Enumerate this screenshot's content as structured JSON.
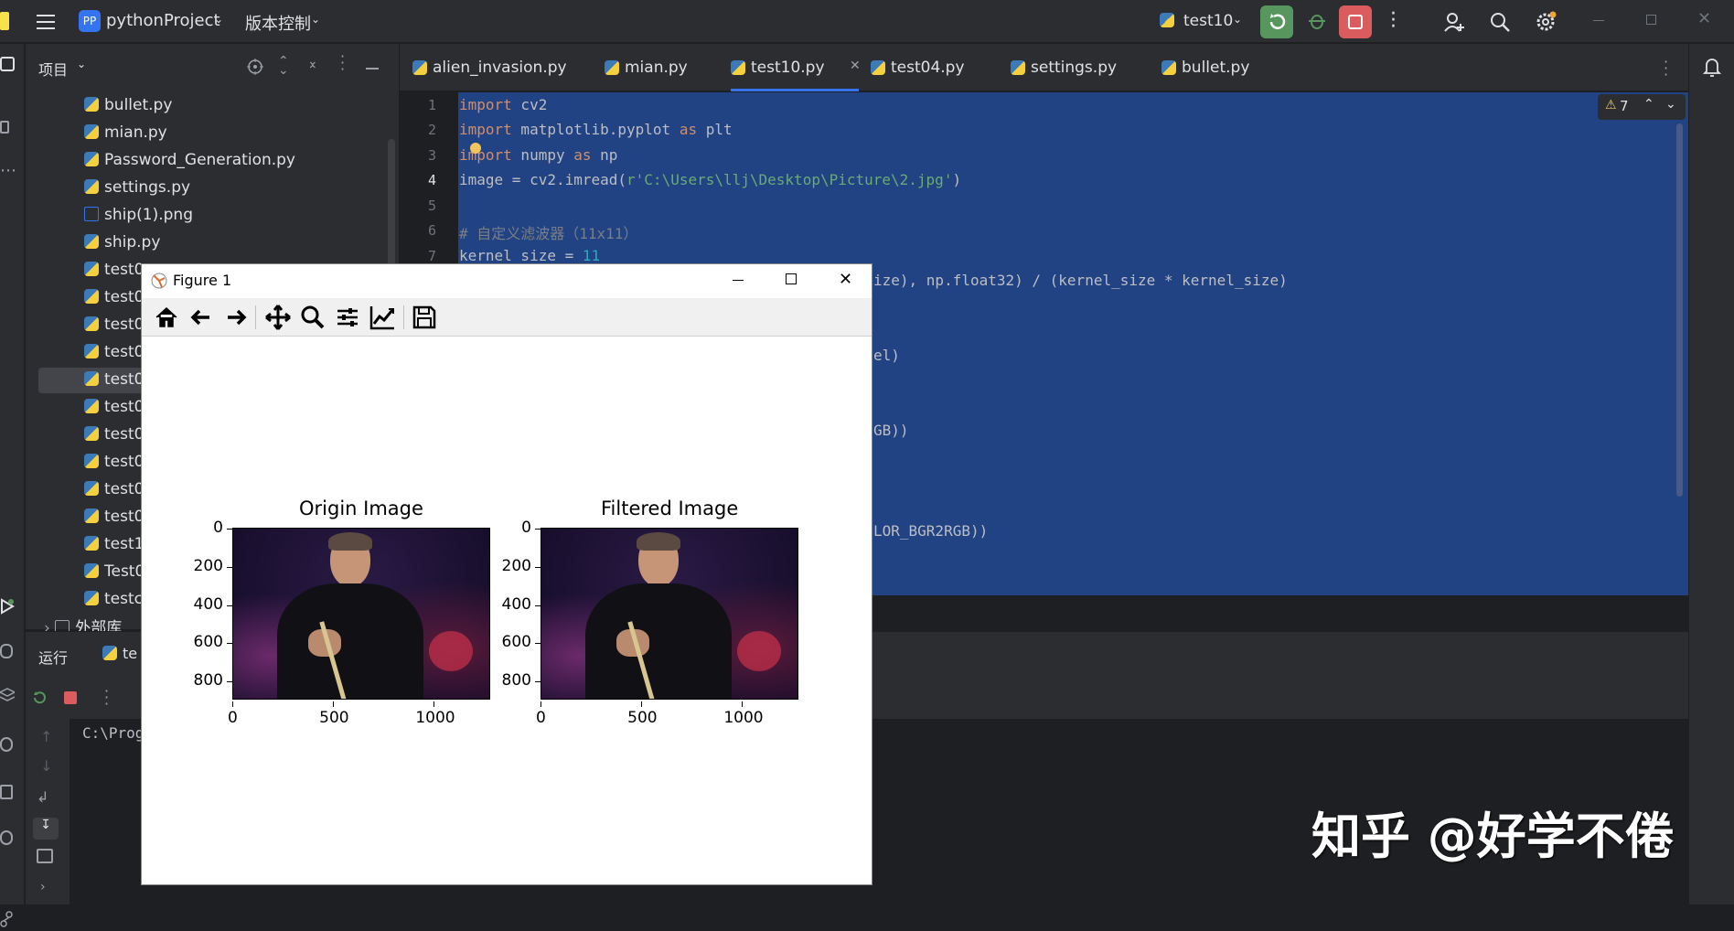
{
  "titlebar": {
    "project_badge": "PP",
    "project_name": "pythonProject",
    "vcs_label": "版本控制",
    "run_config": "test10"
  },
  "project_panel": {
    "header": "项目",
    "items": [
      "bullet.py",
      "mian.py",
      "Password_Generation.py",
      "settings.py",
      "ship(1).png",
      "ship.py",
      "test0",
      "test0",
      "test0",
      "test0",
      "test0",
      "test0",
      "test0",
      "test0",
      "test0",
      "test0",
      "test1",
      "Test0",
      "testc",
      "外部库"
    ]
  },
  "tabs": [
    {
      "label": "alien_invasion.py"
    },
    {
      "label": "mian.py"
    },
    {
      "label": "test10.py",
      "active": true
    },
    {
      "label": "test04.py"
    },
    {
      "label": "settings.py"
    },
    {
      "label": "bullet.py"
    }
  ],
  "editor": {
    "line_numbers": [
      "1",
      "2",
      "3",
      "4",
      "5",
      "6",
      "7"
    ],
    "warnings_count": "7",
    "fragments": {
      "line8": "ize), np.float32) / (kernel_size * kernel_size)",
      "line10": "el)",
      "line13": "GB))",
      "line17": "LOR_BGR2RGB))"
    }
  },
  "bottom": {
    "run_tab": "运行",
    "run_item": "te",
    "console_text": "C:\\Prog"
  },
  "figure": {
    "window_title": "Figure 1",
    "axes": [
      {
        "title": "Origin Image",
        "yticks": [
          "0",
          "200",
          "400",
          "600",
          "800"
        ],
        "xticks": [
          "0",
          "500",
          "1000"
        ]
      },
      {
        "title": "Filtered Image",
        "yticks": [
          "0",
          "200",
          "400",
          "600",
          "800"
        ],
        "xticks": [
          "0",
          "500",
          "1000"
        ]
      }
    ]
  },
  "watermark": "知乎 @好学不倦",
  "colors": {
    "selection": "#214283",
    "keyword": "#cf8e6d",
    "string": "#6aab73",
    "comment": "#7a7e85",
    "number": "#2aacb8",
    "run_green": "#57965c",
    "stop_red": "#db5c5c"
  }
}
